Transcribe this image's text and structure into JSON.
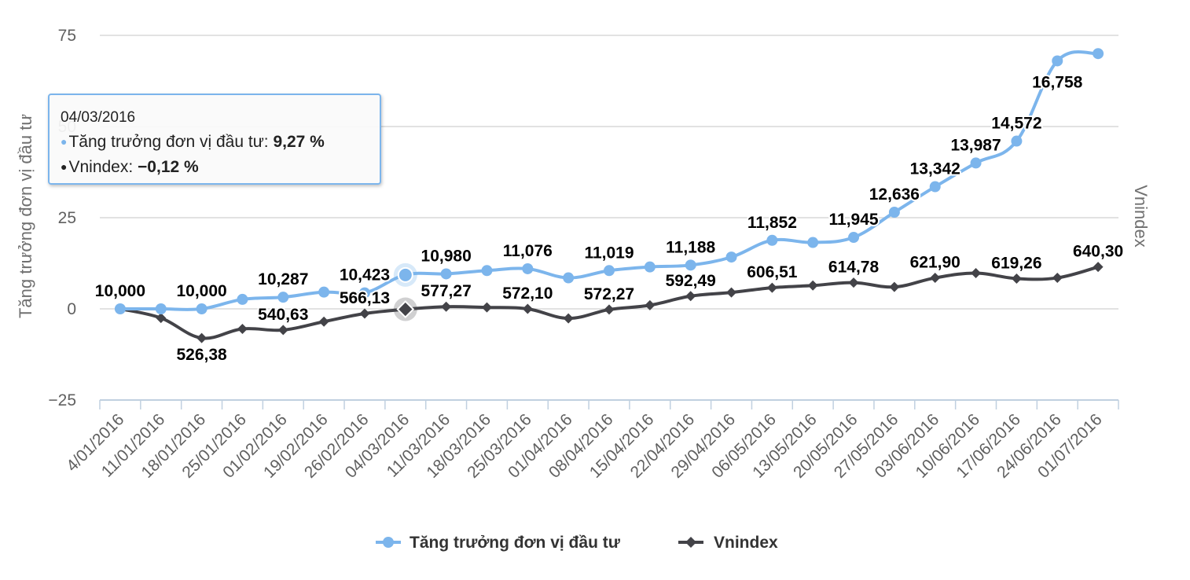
{
  "chart_data": {
    "type": "line",
    "ylabel": "Tăng trưởng đơn vị đầu tư",
    "ylabel_right": "Vnindex",
    "ylim": [
      -25,
      75
    ],
    "yticks": [
      -25,
      0,
      25,
      50,
      75
    ],
    "yticklabels": [
      "−25",
      "0",
      "25",
      "50",
      "75"
    ],
    "grid": true,
    "legend_position": "bottom",
    "categories": [
      "4/01/2016",
      "11/01/2016",
      "18/01/2016",
      "25/01/2016",
      "01/02/2016",
      "19/02/2016",
      "26/02/2016",
      "04/03/2016",
      "11/03/2016",
      "18/03/2016",
      "25/03/2016",
      "01/04/2016",
      "08/04/2016",
      "15/04/2016",
      "22/04/2016",
      "29/04/2016",
      "06/05/2016",
      "13/05/2016",
      "20/05/2016",
      "27/05/2016",
      "03/06/2016",
      "10/06/2016",
      "17/06/2016",
      "24/06/2016",
      "01/07/2016"
    ],
    "series": [
      {
        "name": "Tăng trưởng đơn vị đầu tư",
        "color": "#7cb5ec",
        "marker": "circle",
        "values": [
          0,
          0,
          0,
          2.6,
          3.2,
          4.6,
          4.4,
          9.3,
          9.6,
          10.5,
          11.0,
          8.5,
          10.5,
          11.5,
          12.0,
          14.2,
          18.8,
          18.2,
          19.6,
          26.5,
          33.5,
          40.0,
          46.0,
          68.0,
          70.0
        ],
        "labels": [
          "10,000",
          "",
          "10,000",
          "",
          "10,287",
          "",
          "10,423",
          "",
          "10,980",
          "",
          "11,076",
          "",
          "11,019",
          "",
          "11,188",
          "",
          "11,852",
          "",
          "11,945",
          "12,636",
          "13,342",
          "13,987",
          "14,572",
          "16,758",
          ""
        ]
      },
      {
        "name": "Vnindex",
        "color": "#434348",
        "marker": "diamond",
        "values": [
          0,
          -2.5,
          -8.0,
          -5.5,
          -5.8,
          -3.5,
          -1.3,
          -0.12,
          0.6,
          0.4,
          0.0,
          -2.6,
          -0.2,
          1.0,
          3.5,
          4.5,
          5.8,
          6.4,
          7.2,
          6.0,
          8.5,
          9.8,
          8.3,
          8.5,
          11.5
        ],
        "labels": [
          "",
          "",
          "526,38",
          "",
          "540,63",
          "",
          "566,13",
          "",
          "577,27",
          "",
          "572,10",
          "",
          "572,27",
          "",
          "592,49",
          "",
          "606,51",
          "",
          "614,78",
          "",
          "621,90",
          "",
          "619,26",
          "",
          "640,30"
        ]
      }
    ],
    "highlight_index": 7
  },
  "tooltip": {
    "date": "04/03/2016",
    "rows": [
      {
        "label": "Tăng trưởng đơn vị đầu tư:",
        "value": "9,27 %",
        "color": "#7cb5ec"
      },
      {
        "label": "Vnindex:",
        "value": "−0,12 %",
        "color": "#222222"
      }
    ]
  }
}
